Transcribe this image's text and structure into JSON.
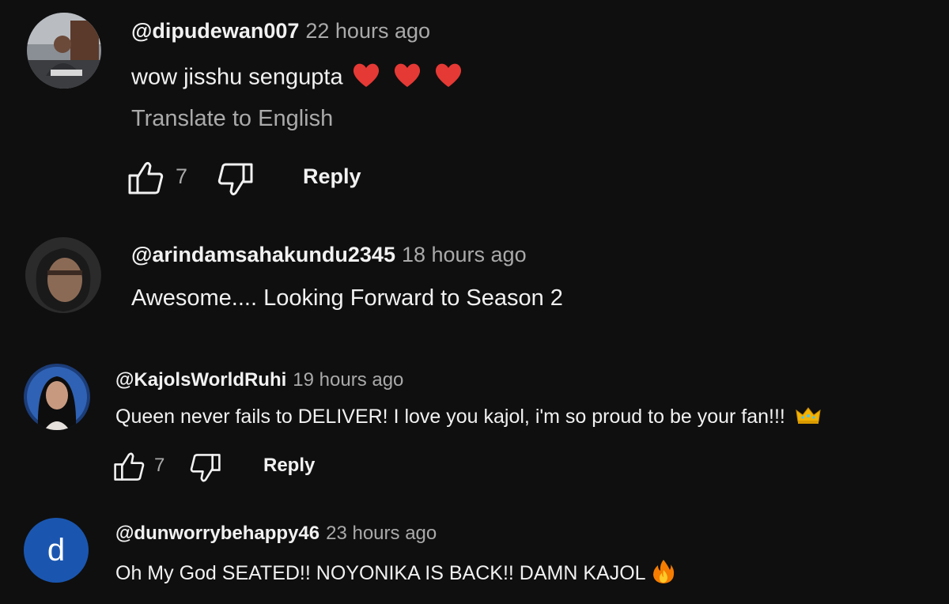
{
  "comments": [
    {
      "handle": "@dipudewan007",
      "time": "22 hours ago",
      "text": "wow jisshu sengupta",
      "translate_label": "Translate to English",
      "likes": "7",
      "reply_label": "Reply",
      "emoji": "red-heart x3"
    },
    {
      "handle": "@arindamsahakundu2345",
      "time": "18 hours ago",
      "text": "Awesome.... Looking Forward to Season 2"
    },
    {
      "handle": "@KajolsWorldRuhi",
      "time": "19 hours ago",
      "text": "Queen never fails to DELIVER! I love you kajol, i'm so proud to be your fan!!!",
      "likes": "7",
      "reply_label": "Reply",
      "emoji": "crown"
    },
    {
      "handle": "@dunworrybehappy46",
      "time": "23 hours ago",
      "text": "Oh My God SEATED!! NOYONIKA IS BACK!! DAMN KAJOL",
      "avatar_initial": "d",
      "avatar_color": "#1a56b0",
      "emoji": "fire"
    }
  ],
  "colors": {
    "background": "#0f0f0f",
    "primary_text": "#f1f1f1",
    "secondary_text": "#aaaaaa"
  },
  "icons": [
    "like-icon",
    "dislike-icon",
    "heart-icon",
    "crown-icon",
    "fire-icon"
  ]
}
